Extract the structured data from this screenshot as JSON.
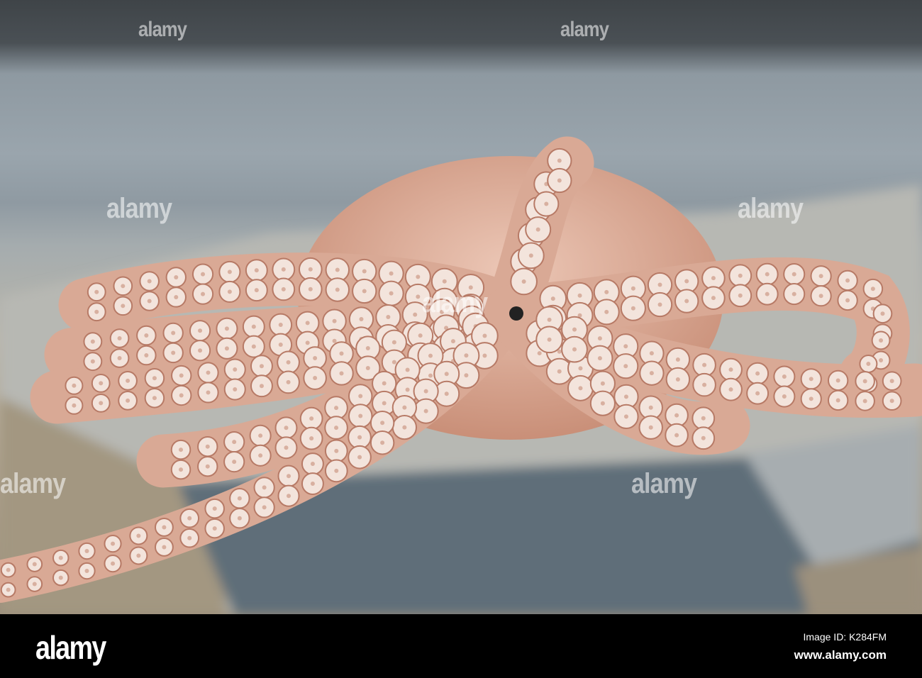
{
  "watermark": {
    "text": "alamy"
  },
  "footer": {
    "logo": "alamy",
    "image_id": "Image ID: K284FM",
    "website": "www.alamy.com"
  },
  "colors": {
    "skin": "#d9a995",
    "sucker": "#f3e4dc",
    "shadow": "#55636e",
    "footer": "#000000"
  }
}
